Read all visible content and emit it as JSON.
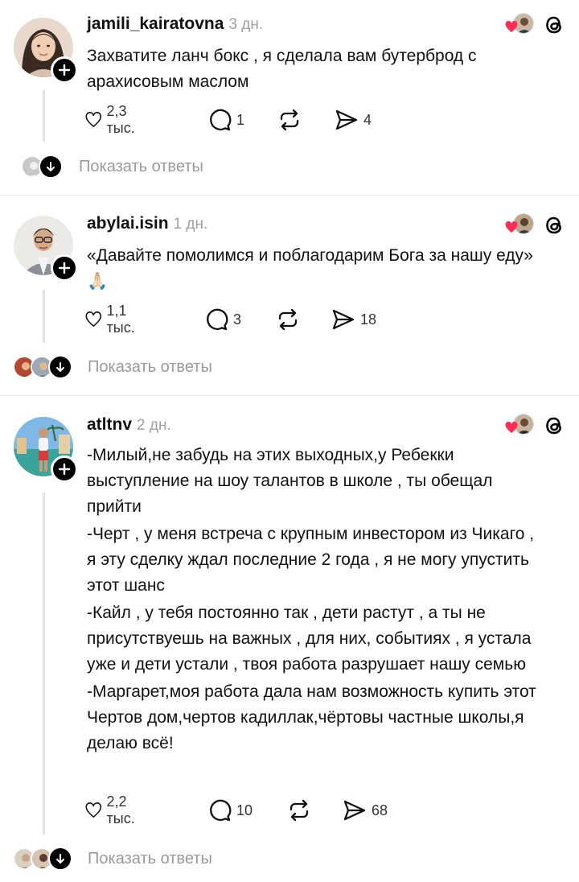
{
  "posts": [
    {
      "username": "jamili_kairatovna",
      "time": "3 дн.",
      "lines": [
        "Захватите ланч бокс , я сделала вам бутерброд с арахисовым маслом"
      ],
      "likes": "2,3 тыс.",
      "comments": "1",
      "reposts": "",
      "shares": "4",
      "show_replies": "Показать ответы"
    },
    {
      "username": "abylai.isin",
      "time": "1 дн.",
      "lines": [
        "«Давайте помолимся и поблагодарим Бога за нашу еду» 🙏🏻"
      ],
      "likes": "1,1 тыс.",
      "comments": "3",
      "reposts": "",
      "shares": "18",
      "show_replies": "Показать ответы"
    },
    {
      "username": "atltnv",
      "time": "2 дн.",
      "lines": [
        "-Милый,не забудь на этих выходных,у Ребекки выступление на шоу талантов в школе , ты обещал прийти",
        "-Черт , у меня встреча с крупным инвестором из Чикаго , я эту сделку ждал последние 2 года , я не могу упустить этот шанс",
        "-Кайл , у тебя постоянно так , дети растут , а ты не присутствуешь на важных , для них, событиях , я устала уже и дети устали , твоя работа разрушает нашу семью",
        "-Маргарет,моя работа дала нам возможность купить этот Чертов дом,чертов кадиллак,чёртовы частные школы,я делаю всё!"
      ],
      "likes": "2,2 тыс.",
      "comments": "10",
      "reposts": "",
      "shares": "68",
      "show_replies": "Показать ответы"
    }
  ],
  "icons": {
    "like": "heart-outline-icon",
    "comment": "comment-bubble-icon",
    "repost": "repost-arrows-icon",
    "share": "send-plane-icon",
    "follow": "plus-icon",
    "expand": "arrow-down-icon",
    "app": "threads-logo-icon",
    "reaction": "red-heart-icon"
  },
  "colors": {
    "text": "#111111",
    "muted": "#9a9a9a",
    "heart": "#ff2d55",
    "badge": "#000000",
    "divider": "#e6e6e6"
  }
}
